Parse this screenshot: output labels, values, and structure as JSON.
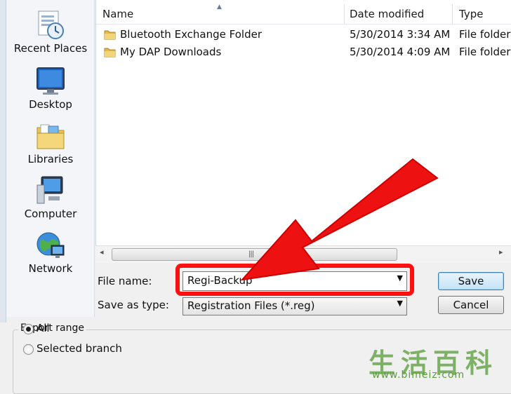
{
  "places": [
    {
      "label": "Recent Places",
      "icon": "recent-places-icon"
    },
    {
      "label": "Desktop",
      "icon": "desktop-icon"
    },
    {
      "label": "Libraries",
      "icon": "libraries-icon"
    },
    {
      "label": "Computer",
      "icon": "computer-icon"
    },
    {
      "label": "Network",
      "icon": "network-icon"
    }
  ],
  "columns": {
    "name": "Name",
    "date": "Date modified",
    "type": "Type"
  },
  "rows": [
    {
      "name": "Bluetooth Exchange Folder",
      "date": "5/30/2014 3:34 AM",
      "type": "File folder"
    },
    {
      "name": "My DAP Downloads",
      "date": "5/30/2014 4:09 AM",
      "type": "File folder"
    }
  ],
  "scroll": {
    "left": "◂",
    "right": "▸",
    "grip": "|||"
  },
  "form": {
    "file_name_label": "File name:",
    "file_name_value": "Regi-Backup",
    "save_type_label": "Save as type:",
    "save_type_value": "Registration Files (*.reg)",
    "dropdown": "▼"
  },
  "buttons": {
    "save": "Save",
    "cancel": "Cancel"
  },
  "export": {
    "title": "Export range",
    "all": "All",
    "selected_branch": "Selected branch"
  },
  "watermark": {
    "chars": "生活百科",
    "url": "www.bimeiz.com"
  },
  "colors": {
    "highlight": "#ff1010",
    "arrow": "#ee1111",
    "watermark": "#6aa84f"
  }
}
